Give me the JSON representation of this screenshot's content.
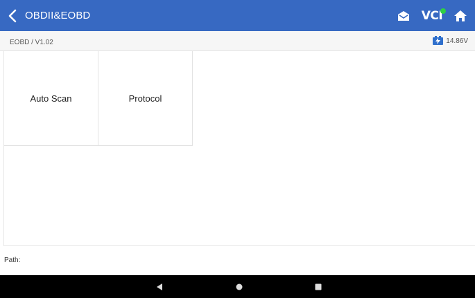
{
  "header": {
    "title": "OBDII&EOBD",
    "icons": {
      "back": "chevron-left-icon",
      "mail": "mail-icon",
      "vci": "VCI",
      "home": "home-icon"
    },
    "color": "#3769c2"
  },
  "subbar": {
    "version": "EOBD / V1.02",
    "voltage": "14.86V"
  },
  "menu": {
    "tiles": [
      {
        "label": "Auto Scan"
      },
      {
        "label": "Protocol"
      }
    ]
  },
  "footer": {
    "path_label": "Path:"
  },
  "colors": {
    "accent": "#3769c2",
    "vci_status": "#2fcf44",
    "battery": "#2f6fcc"
  }
}
